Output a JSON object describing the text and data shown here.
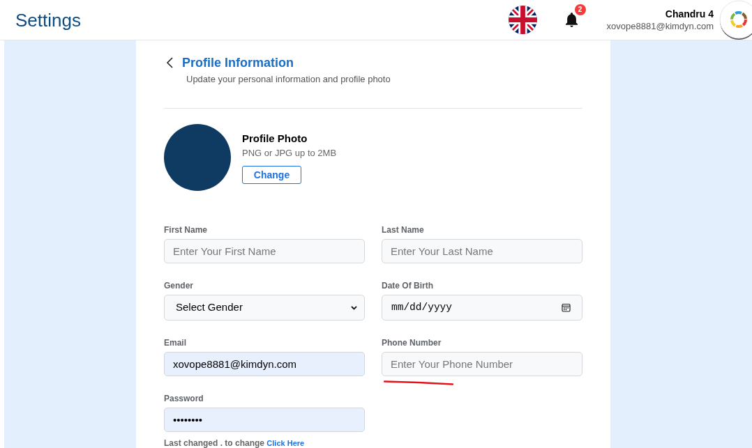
{
  "header": {
    "title": "Settings",
    "notifications": {
      "count": "2"
    },
    "user": {
      "name": "Chandru 4",
      "email": "xovope8881@kimdyn.com"
    }
  },
  "profile": {
    "title": "Profile Information",
    "subtitle": "Update your personal information and profile photo",
    "photo": {
      "title": "Profile Photo",
      "hint": "PNG or JPG up to 2MB",
      "button": "Change"
    }
  },
  "form": {
    "fields": [
      {
        "kind": "text",
        "label": "First Name",
        "placeholder": "Enter Your First Name",
        "autofilled": false,
        "underlined": false
      },
      {
        "kind": "text",
        "label": "Last Name",
        "placeholder": "Enter Your Last Name",
        "autofilled": false,
        "underlined": false
      },
      {
        "kind": "select",
        "label": "Gender",
        "value": "Select Gender",
        "autofilled": false,
        "underlined": false
      },
      {
        "kind": "date",
        "label": "Date Of Birth",
        "value": "mm/dd/yyyy",
        "autofilled": false,
        "underlined": false
      },
      {
        "kind": "text",
        "label": "Email",
        "value": "xovope8881@kimdyn.com",
        "autofilled": true,
        "underlined": false
      },
      {
        "kind": "text",
        "label": "Phone Number",
        "placeholder": "Enter Your Phone Number",
        "autofilled": false,
        "underlined": true
      },
      {
        "kind": "text",
        "label": "Password",
        "value": "••••••••",
        "autofilled": true,
        "underlined": false
      }
    ],
    "password_note": {
      "text": "Last changed . to change",
      "link": "Click Here"
    }
  }
}
